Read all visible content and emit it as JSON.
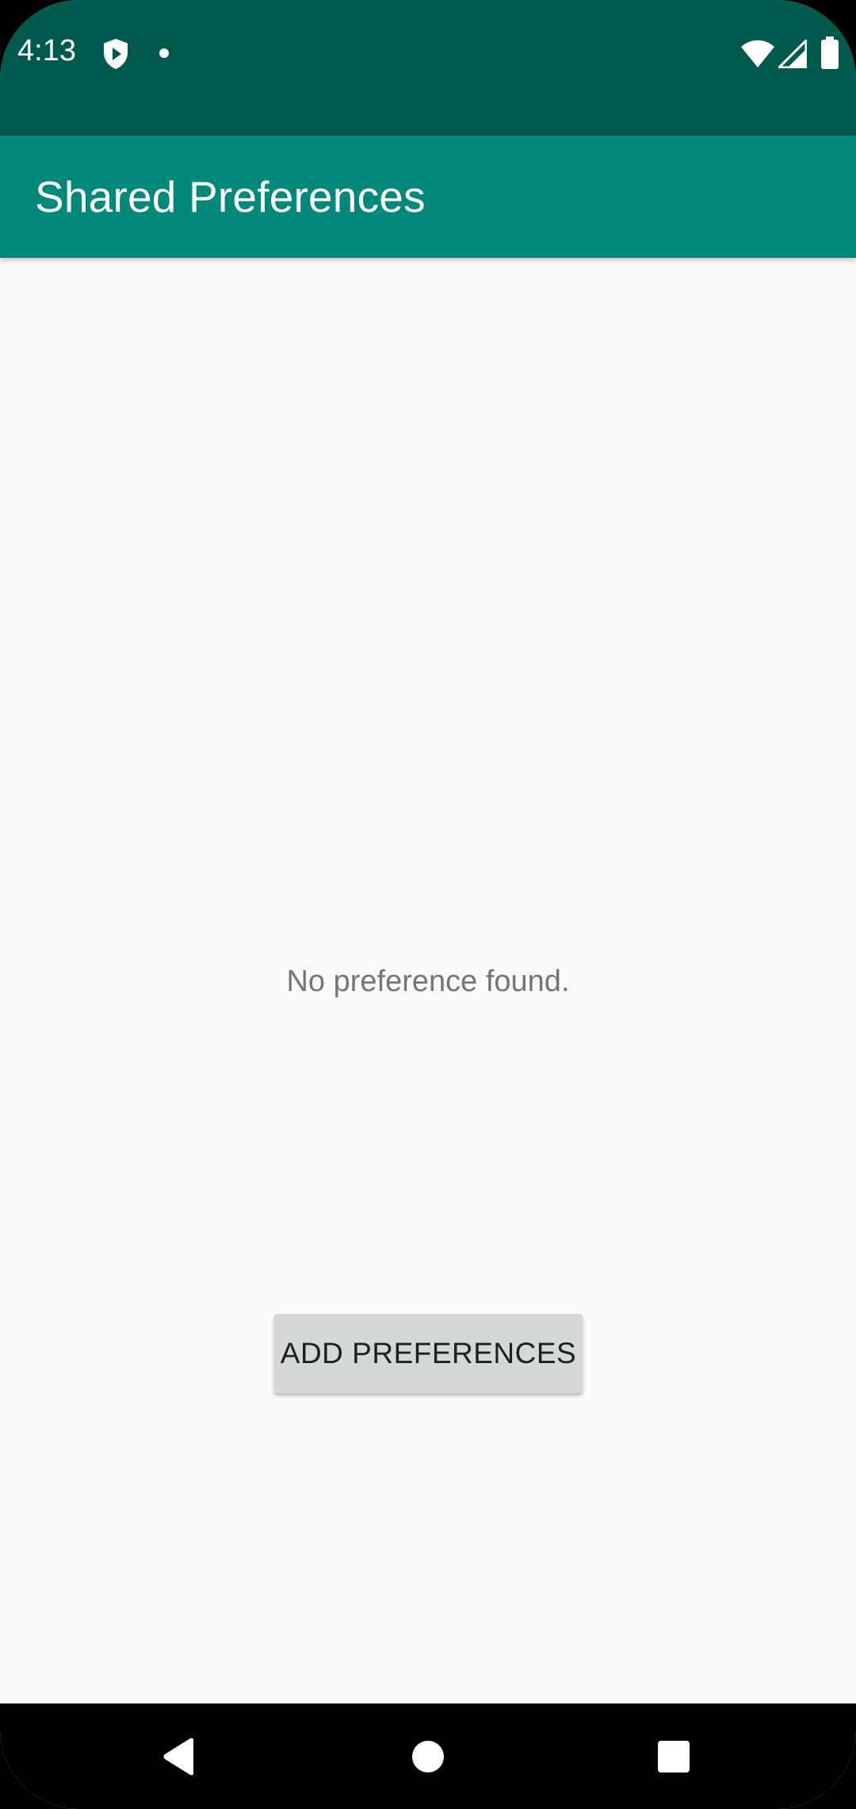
{
  "status_bar": {
    "time": "4:13",
    "icons": [
      "shield-play-icon",
      "notification-dot-icon",
      "wifi-icon",
      "cellular-signal-icon",
      "battery-icon"
    ]
  },
  "app_bar": {
    "title": "Shared Preferences"
  },
  "main": {
    "empty_message": "No preference found.",
    "add_button_label": "ADD PREFERENCES"
  },
  "nav_bar": {
    "buttons": [
      "back-icon",
      "home-icon",
      "recents-icon"
    ]
  },
  "colors": {
    "status_bar": "#00594D",
    "app_bar": "#00897B",
    "background": "#FAFAFA",
    "button": "#D6D7D7",
    "message_text": "#757575"
  }
}
